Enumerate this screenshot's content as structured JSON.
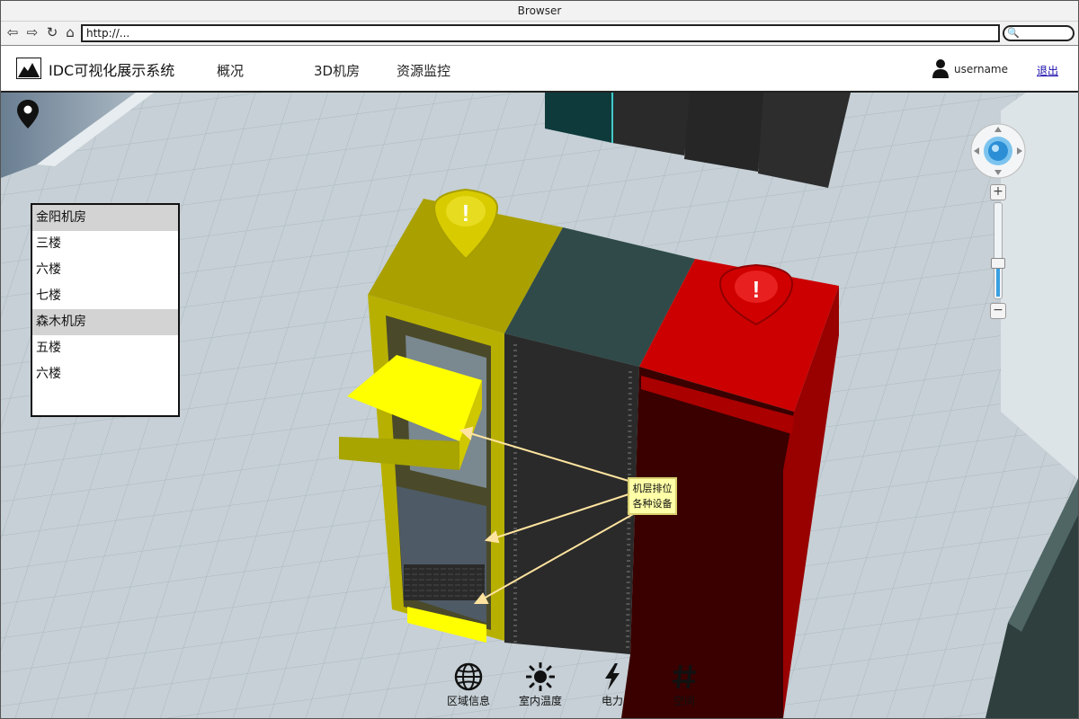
{
  "browser": {
    "title": "Browser",
    "url": "http://..."
  },
  "app": {
    "title": "IDC可视化展示系统",
    "nav": [
      "概况",
      "3D机房",
      "资源监控"
    ],
    "username": "username",
    "logout": "退出"
  },
  "rooms": [
    {
      "label": "金阳机房",
      "type": "group"
    },
    {
      "label": "三楼",
      "type": "floor"
    },
    {
      "label": "六楼",
      "type": "floor"
    },
    {
      "label": "七楼",
      "type": "floor"
    },
    {
      "label": "森木机房",
      "type": "group"
    },
    {
      "label": "五楼",
      "type": "floor"
    },
    {
      "label": "六楼",
      "type": "floor"
    }
  ],
  "annotation": {
    "line1": "机层排位",
    "line2": "各种设备"
  },
  "alerts": [
    {
      "symbol": "!",
      "color": "#d8cc00"
    },
    {
      "symbol": "!",
      "color": "#d00000"
    }
  ],
  "toolbar": [
    {
      "label": "区域信息",
      "icon": "globe-icon"
    },
    {
      "label": "室内温度",
      "icon": "sun-icon"
    },
    {
      "label": "电力",
      "icon": "lightning-icon"
    },
    {
      "label": "空间",
      "icon": "hash-icon"
    }
  ],
  "zoom": {
    "level": 0.35
  },
  "colors": {
    "rack_warning": "#c8c000",
    "rack_normal": "#2f4a48",
    "rack_critical": "#cc0000",
    "highlight": "#ffff00",
    "zoom_accent": "#3aa0e0"
  }
}
